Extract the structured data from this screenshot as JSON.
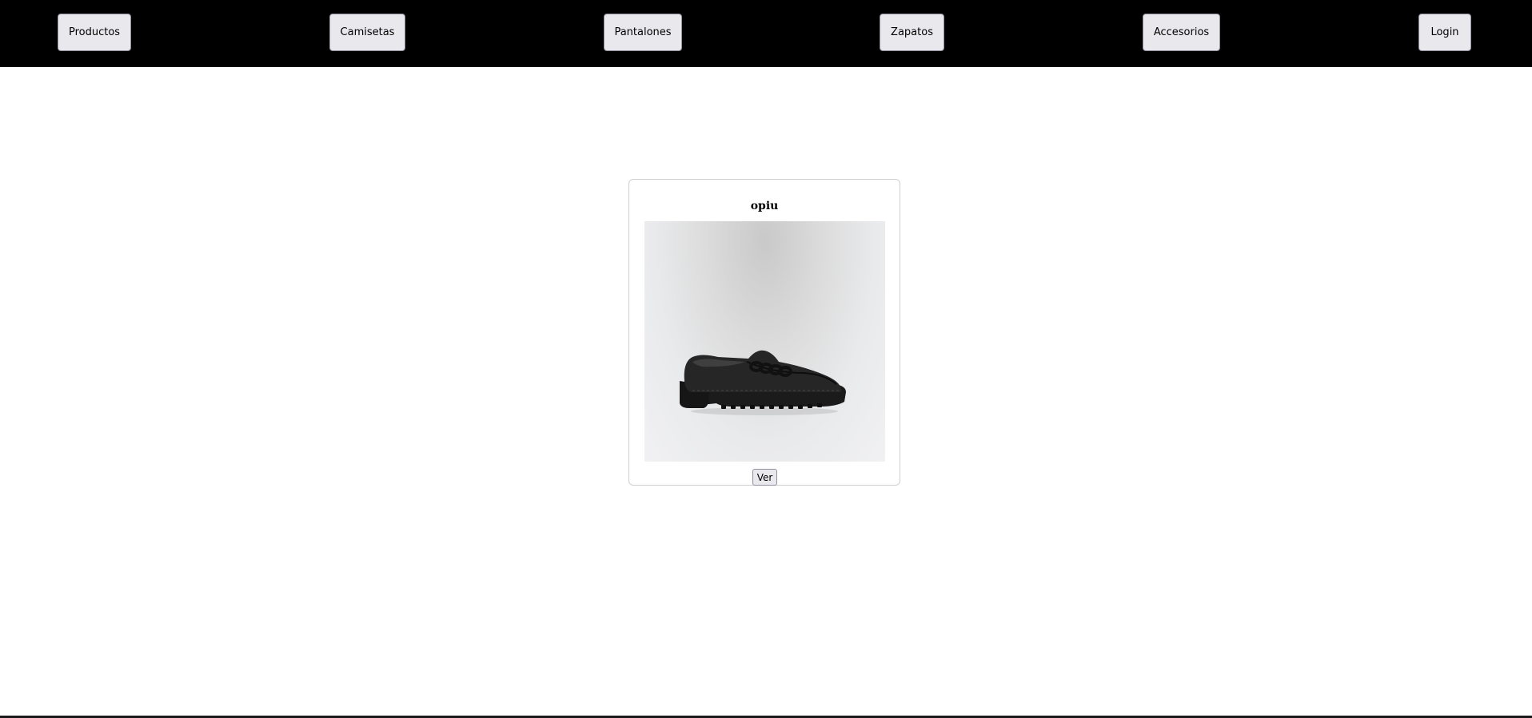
{
  "nav": {
    "items": [
      {
        "label": "Productos"
      },
      {
        "label": "Camisetas"
      },
      {
        "label": "Pantalones"
      },
      {
        "label": "Zapatos"
      },
      {
        "label": "Accesorios"
      },
      {
        "label": "Login"
      }
    ]
  },
  "product": {
    "title": "opiu",
    "image_icon": "black-loafer-shoe",
    "view_label": "Ver"
  },
  "colors": {
    "topbar": "#000000",
    "button_bg": "#e9e9ed",
    "card_border": "#cfcfcf"
  }
}
